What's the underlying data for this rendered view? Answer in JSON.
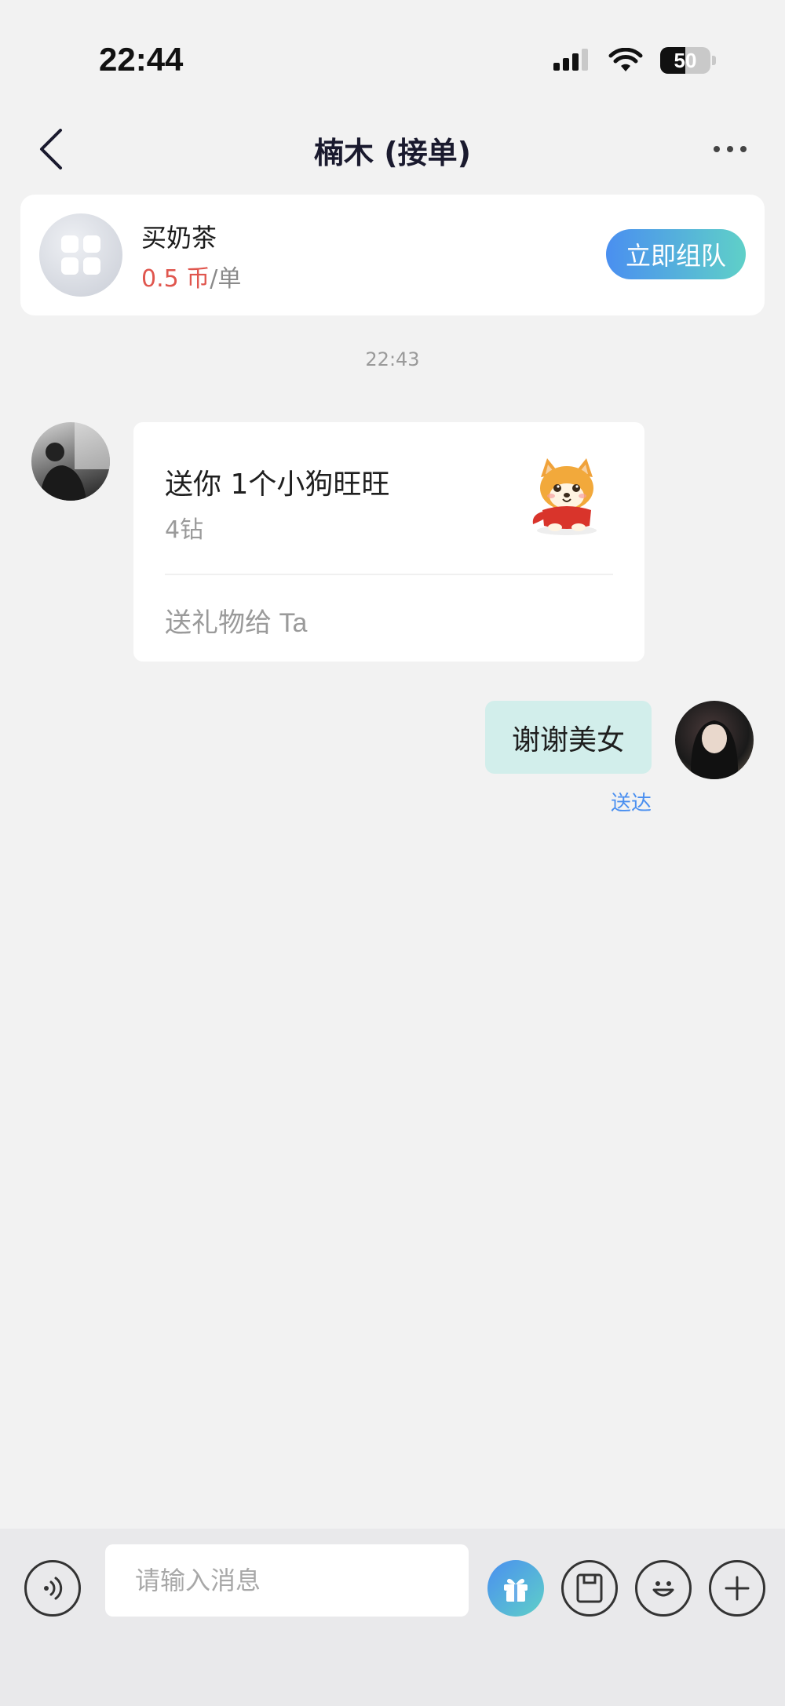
{
  "status_bar": {
    "time": "22:44",
    "battery": "50",
    "battery_level": 0.5
  },
  "nav": {
    "title": "楠木 (接单)",
    "icons": {
      "back": "chevron-left-icon",
      "more": "more-dots-icon"
    }
  },
  "order": {
    "title": "买奶茶",
    "price_value": "0.5 币",
    "price_unit": "/单",
    "action_label": "立即组队",
    "icon": "grid-apps-icon"
  },
  "chat": {
    "timestamp": "22:43",
    "messages": [
      {
        "type": "gift",
        "side": "left",
        "title": "送你 1个小狗旺旺",
        "price": "4钻",
        "action": "送礼物给 Ta",
        "image": "corgi-dog-gift"
      },
      {
        "type": "text",
        "side": "right",
        "text": "谢谢美女",
        "status": "送达"
      }
    ]
  },
  "input_bar": {
    "placeholder": "请输入消息",
    "icons": [
      "voice-icon",
      "gift-icon",
      "card-icon",
      "emoji-icon",
      "plus-icon"
    ]
  },
  "colors": {
    "accent_gradient_start": "#4a8ff0",
    "accent_gradient_end": "#5fd0c8",
    "price_red": "#e0564e",
    "bubble_sent": "#d2eeeb",
    "background": "#f2f2f2"
  }
}
